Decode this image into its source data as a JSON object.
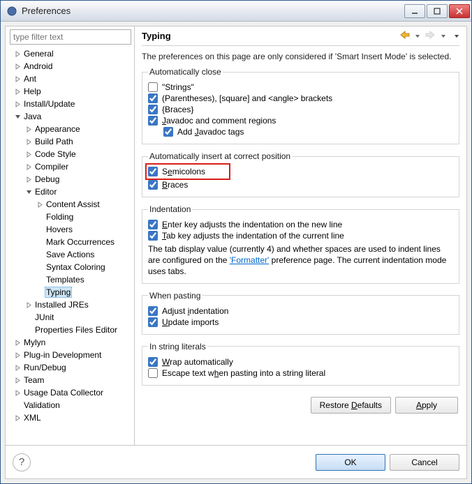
{
  "window": {
    "title": "Preferences"
  },
  "filter": {
    "placeholder": "type filter text"
  },
  "tree": [
    {
      "d": 1,
      "a": "r",
      "t": "General"
    },
    {
      "d": 1,
      "a": "r",
      "t": "Android"
    },
    {
      "d": 1,
      "a": "r",
      "t": "Ant"
    },
    {
      "d": 1,
      "a": "r",
      "t": "Help"
    },
    {
      "d": 1,
      "a": "r",
      "t": "Install/Update"
    },
    {
      "d": 1,
      "a": "d",
      "t": "Java"
    },
    {
      "d": 2,
      "a": "r",
      "t": "Appearance"
    },
    {
      "d": 2,
      "a": "r",
      "t": "Build Path"
    },
    {
      "d": 2,
      "a": "r",
      "t": "Code Style"
    },
    {
      "d": 2,
      "a": "r",
      "t": "Compiler"
    },
    {
      "d": 2,
      "a": "r",
      "t": "Debug"
    },
    {
      "d": 2,
      "a": "d",
      "t": "Editor"
    },
    {
      "d": 3,
      "a": "r",
      "t": "Content Assist"
    },
    {
      "d": 3,
      "a": "",
      "t": "Folding"
    },
    {
      "d": 3,
      "a": "",
      "t": "Hovers"
    },
    {
      "d": 3,
      "a": "",
      "t": "Mark Occurrences"
    },
    {
      "d": 3,
      "a": "",
      "t": "Save Actions"
    },
    {
      "d": 3,
      "a": "",
      "t": "Syntax Coloring"
    },
    {
      "d": 3,
      "a": "",
      "t": "Templates"
    },
    {
      "d": 3,
      "a": "",
      "t": "Typing",
      "sel": true
    },
    {
      "d": 2,
      "a": "r",
      "t": "Installed JREs"
    },
    {
      "d": 2,
      "a": "",
      "t": "JUnit"
    },
    {
      "d": 2,
      "a": "",
      "t": "Properties Files Editor"
    },
    {
      "d": 1,
      "a": "r",
      "t": "Mylyn"
    },
    {
      "d": 1,
      "a": "r",
      "t": "Plug-in Development"
    },
    {
      "d": 1,
      "a": "r",
      "t": "Run/Debug"
    },
    {
      "d": 1,
      "a": "r",
      "t": "Team"
    },
    {
      "d": 1,
      "a": "r",
      "t": "Usage Data Collector"
    },
    {
      "d": 1,
      "a": "",
      "t": "Validation"
    },
    {
      "d": 1,
      "a": "r",
      "t": "XML"
    }
  ],
  "page": {
    "heading": "Typing",
    "desc": "The preferences on this page are only considered if 'Smart Insert Mode' is selected.",
    "g1": {
      "legend": "Automatically close",
      "strings": "\"Strings\"",
      "parens": "(Parentheses), [square] and <angle> brackets",
      "braces": "{Braces}",
      "javadoc": "Javadoc and comment regions",
      "addtags": "Add Javadoc tags"
    },
    "g2": {
      "legend": "Automatically insert at correct position",
      "semicolons": "Semicolons",
      "braces": "Braces"
    },
    "g3": {
      "legend": "Indentation",
      "enter": "Enter key adjusts the indentation on the new line",
      "tab": "Tab key adjusts the indentation of the current line",
      "note_pre": "The tab display value (currently 4) and whether spaces are used to indent lines are configured on the ",
      "note_link": "'Formatter'",
      "note_post": " preference page. The current indentation mode uses tabs."
    },
    "g4": {
      "legend": "When pasting",
      "adjust": "Adjust indentation",
      "update": "Update imports"
    },
    "g5": {
      "legend": "In string literals",
      "wrap": "Wrap automatically",
      "escape": "Escape text when pasting into a string literal"
    },
    "buttons": {
      "restore": "Restore Defaults",
      "apply": "Apply"
    }
  },
  "footer": {
    "ok": "OK",
    "cancel": "Cancel"
  }
}
